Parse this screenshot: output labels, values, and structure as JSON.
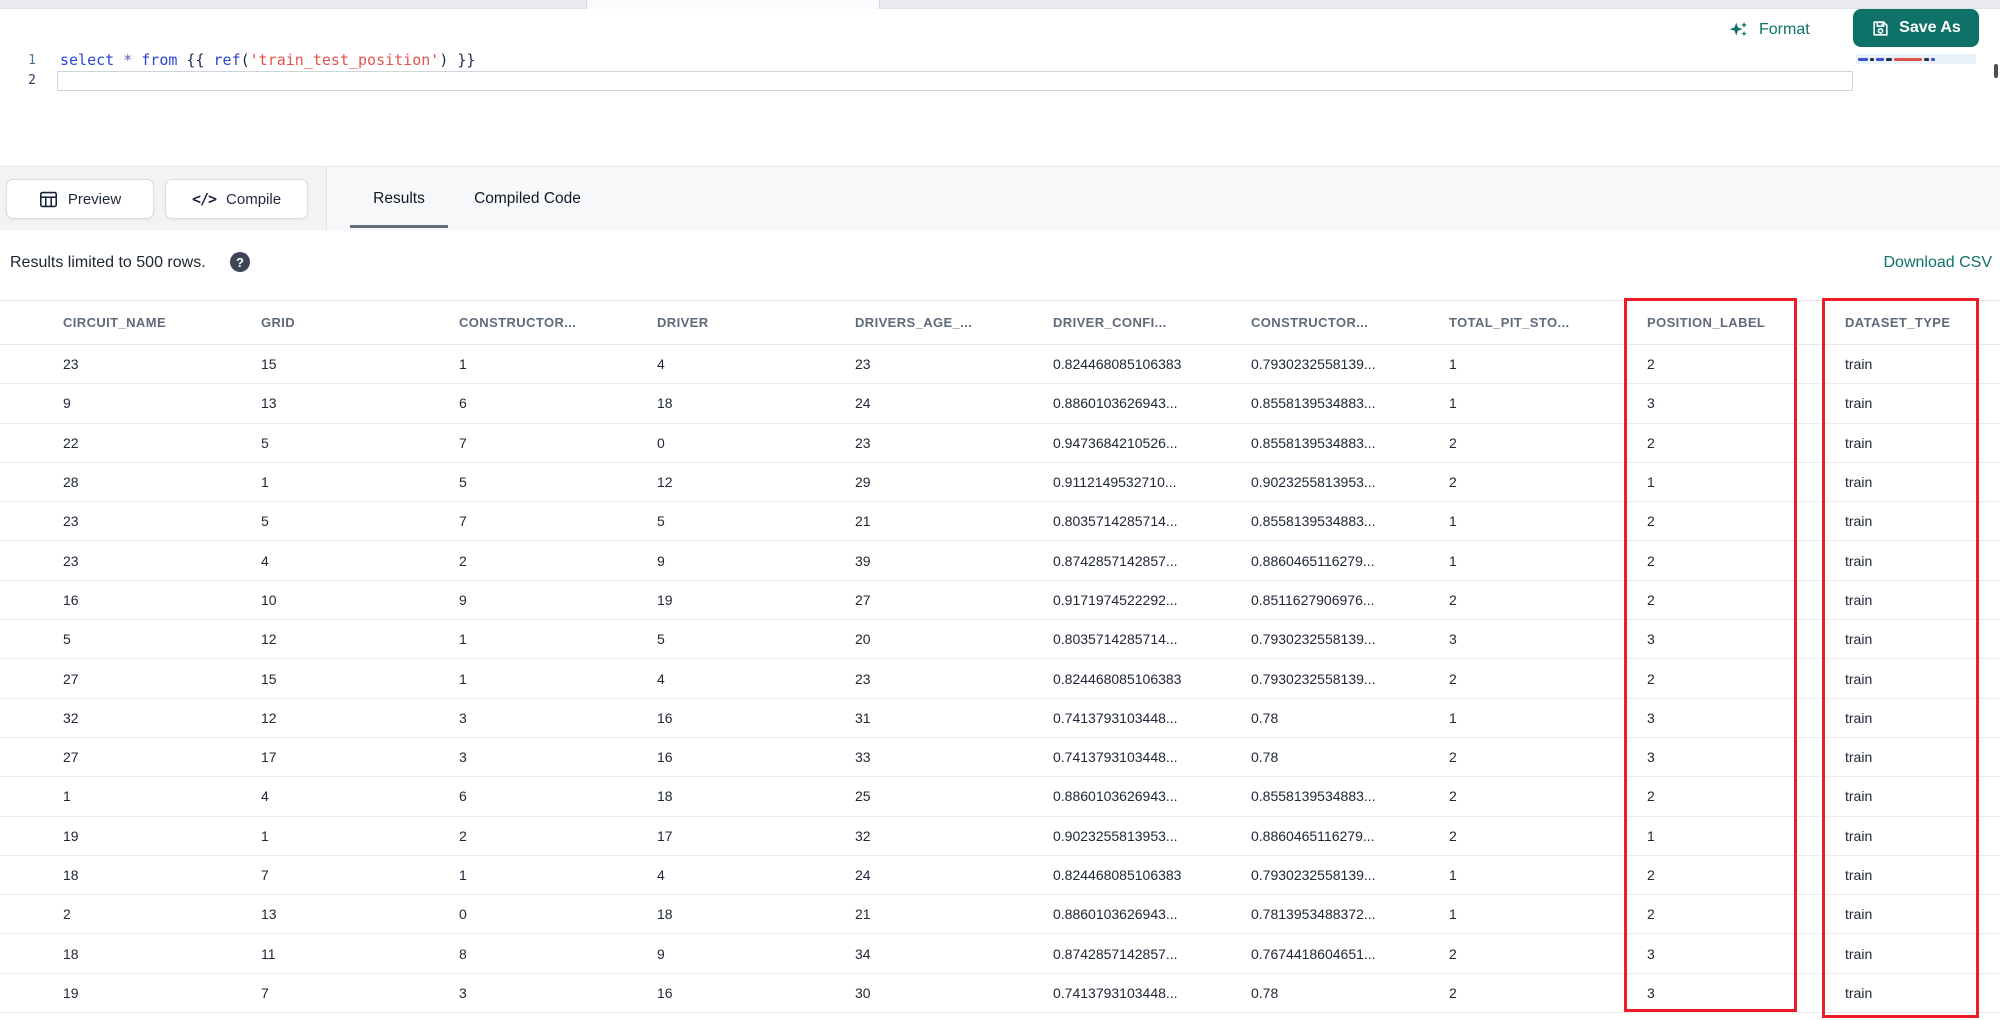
{
  "top": {
    "format_label": "Format",
    "save_as_label": "Save As"
  },
  "editor": {
    "line_numbers": [
      "1",
      "2"
    ],
    "line1_tokens": [
      {
        "type": "kw",
        "text": "select"
      },
      {
        "type": "plain",
        "text": " "
      },
      {
        "type": "op",
        "text": "*"
      },
      {
        "type": "plain",
        "text": " "
      },
      {
        "type": "kw",
        "text": "from"
      },
      {
        "type": "brace",
        "text": " {{ "
      },
      {
        "type": "kw",
        "text": "ref"
      },
      {
        "type": "brace",
        "text": "("
      },
      {
        "type": "str",
        "text": "'train_test_position'"
      },
      {
        "type": "brace",
        "text": ")"
      },
      {
        "type": "brace",
        "text": " }}"
      }
    ]
  },
  "actions": {
    "preview_label": "Preview",
    "compile_label": "Compile"
  },
  "tabs": [
    {
      "label": "Results",
      "active": true
    },
    {
      "label": "Compiled Code",
      "active": false
    }
  ],
  "results": {
    "limit_note": "Results limited to 500 rows.",
    "help_icon": "question-mark-circle",
    "download_csv_label": "Download CSV"
  },
  "table": {
    "columns": [
      "CIRCUIT_NAME",
      "GRID",
      "CONSTRUCTOR...",
      "DRIVER",
      "DRIVERS_AGE_...",
      "DRIVER_CONFI...",
      "CONSTRUCTOR...",
      "TOTAL_PIT_STO...",
      "POSITION_LABEL",
      "DATASET_TYPE"
    ],
    "highlighted_columns": [
      "POSITION_LABEL",
      "DATASET_TYPE"
    ],
    "rows": [
      [
        "23",
        "15",
        "1",
        "4",
        "23",
        "0.824468085106383",
        "0.7930232558139...",
        "1",
        "2",
        "train"
      ],
      [
        "9",
        "13",
        "6",
        "18",
        "24",
        "0.8860103626943...",
        "0.8558139534883...",
        "1",
        "3",
        "train"
      ],
      [
        "22",
        "5",
        "7",
        "0",
        "23",
        "0.9473684210526...",
        "0.8558139534883...",
        "2",
        "2",
        "train"
      ],
      [
        "28",
        "1",
        "5",
        "12",
        "29",
        "0.9112149532710...",
        "0.9023255813953...",
        "2",
        "1",
        "train"
      ],
      [
        "23",
        "5",
        "7",
        "5",
        "21",
        "0.8035714285714...",
        "0.8558139534883...",
        "1",
        "2",
        "train"
      ],
      [
        "23",
        "4",
        "2",
        "9",
        "39",
        "0.8742857142857...",
        "0.8860465116279...",
        "1",
        "2",
        "train"
      ],
      [
        "16",
        "10",
        "9",
        "19",
        "27",
        "0.9171974522292...",
        "0.8511627906976...",
        "2",
        "2",
        "train"
      ],
      [
        "5",
        "12",
        "1",
        "5",
        "20",
        "0.8035714285714...",
        "0.7930232558139...",
        "3",
        "3",
        "train"
      ],
      [
        "27",
        "15",
        "1",
        "4",
        "23",
        "0.824468085106383",
        "0.7930232558139...",
        "2",
        "2",
        "train"
      ],
      [
        "32",
        "12",
        "3",
        "16",
        "31",
        "0.7413793103448...",
        "0.78",
        "1",
        "3",
        "train"
      ],
      [
        "27",
        "17",
        "3",
        "16",
        "33",
        "0.7413793103448...",
        "0.78",
        "2",
        "3",
        "train"
      ],
      [
        "1",
        "4",
        "6",
        "18",
        "25",
        "0.8860103626943...",
        "0.8558139534883...",
        "2",
        "2",
        "train"
      ],
      [
        "19",
        "1",
        "2",
        "17",
        "32",
        "0.9023255813953...",
        "0.8860465116279...",
        "2",
        "1",
        "train"
      ],
      [
        "18",
        "7",
        "1",
        "4",
        "24",
        "0.824468085106383",
        "0.7930232558139...",
        "1",
        "2",
        "train"
      ],
      [
        "2",
        "13",
        "0",
        "18",
        "21",
        "0.8860103626943...",
        "0.7813953488372...",
        "1",
        "2",
        "train"
      ],
      [
        "18",
        "11",
        "8",
        "9",
        "34",
        "0.8742857142857...",
        "0.7674418604651...",
        "2",
        "3",
        "train"
      ],
      [
        "19",
        "7",
        "3",
        "16",
        "30",
        "0.7413793103448...",
        "0.78",
        "2",
        "3",
        "train"
      ]
    ]
  },
  "colors": {
    "accent_teal": "#0f7268",
    "highlight_red": "#ee1c25"
  }
}
